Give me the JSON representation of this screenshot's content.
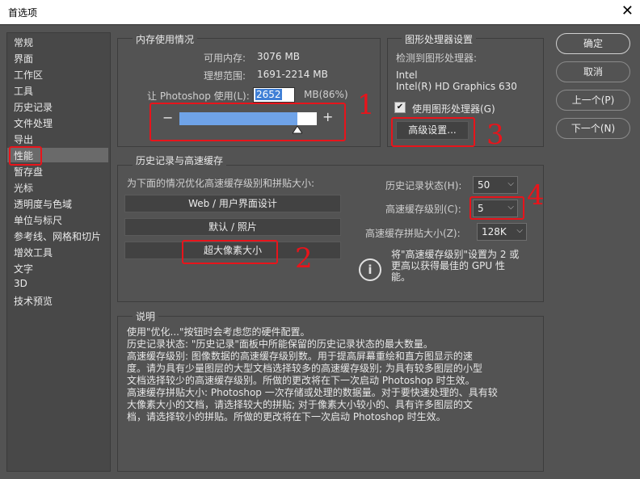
{
  "window": {
    "title": "首选项",
    "close": "✕"
  },
  "sidebar": {
    "items": [
      {
        "label": "常规"
      },
      {
        "label": "界面"
      },
      {
        "label": "工作区"
      },
      {
        "label": "工具"
      },
      {
        "label": "历史记录"
      },
      {
        "label": "文件处理"
      },
      {
        "label": "导出"
      },
      {
        "label": "性能"
      },
      {
        "label": "暂存盘"
      },
      {
        "label": "光标"
      },
      {
        "label": "透明度与色域"
      },
      {
        "label": "单位与标尺"
      },
      {
        "label": "参考线、网格和切片"
      },
      {
        "label": "增效工具"
      },
      {
        "label": "文字"
      },
      {
        "label": "3D"
      },
      {
        "label": "技术预览"
      }
    ],
    "selected": "性能"
  },
  "memory": {
    "title": "内存使用情况",
    "available_label": "可用内存:",
    "available_value": "3076 MB",
    "ideal_label": "理想范围:",
    "ideal_value": "1691-2214 MB",
    "let_label": "让 Photoshop 使用(L):",
    "let_value": "2652",
    "unit_label": "MB(86%)",
    "minus": "−",
    "plus": "+",
    "slider_level": 0.86
  },
  "gpu": {
    "title": "图形处理器设置",
    "detected_label": "检测到图形处理器:",
    "vendor": "Intel",
    "model": "Intel(R) HD Graphics 630",
    "use_label": "使用图形处理器(G)",
    "use_checked": "✔",
    "advanced_button": "高级设置..."
  },
  "buttons": {
    "ok": "确定",
    "cancel": "取消",
    "prev": "上一个(P)",
    "next": "下一个(N)"
  },
  "history": {
    "title": "历史记录与高速缓存",
    "optimize_label": "为下面的情况优化高速缓存级别和拼贴大小:",
    "opt_web": "Web / 用户界面设计",
    "opt_default": "默认 / 照片",
    "opt_huge": "超大像素大小",
    "states_label": "历史记录状态(H):",
    "states_value": "50",
    "cache_levels_label": "高速缓存级别(C):",
    "cache_levels_value": "5",
    "tile_label": "高速缓存拼贴大小(Z):",
    "tile_value": "128K",
    "info_icon": "i",
    "info_line1": "将\"高速缓存级别\"设置为 2 或",
    "info_line2": "更高以获得最佳的 GPU 性",
    "info_line3": "能。",
    "arrow": "⌵"
  },
  "description": {
    "title": "说明",
    "lines": [
      "使用\"优化...\"按钮时会考虑您的硬件配置。",
      "历史记录状态: \"历史记录\"面板中所能保留的历史记录状态的最大数量。",
      "高速缓存级别: 图像数据的高速缓存级别数。用于提高屏幕重绘和直方图显示的速",
      "度。请为具有少量图层的大型文档选择较多的高速缓存级别; 为具有较多图层的小型",
      "文档选择较少的高速缓存级别。所做的更改将在下一次启动 Photoshop 时生效。",
      "高速缓存拼贴大小: Photoshop 一次存储或处理的数据量。对于要快速处理的、具有较",
      "大像素大小的文档，请选择较大的拼贴; 对于像素大小较小的、具有许多图层的文",
      "档，请选择较小的拼贴。所做的更改将在下一次启动 Photoshop 时生效。"
    ]
  },
  "annotations": {
    "n1": "1",
    "n2": "2",
    "n3": "3",
    "n4": "4"
  },
  "colors": {
    "accent_slider": "#6fa3e8",
    "annotation_red": "#e8141b"
  }
}
